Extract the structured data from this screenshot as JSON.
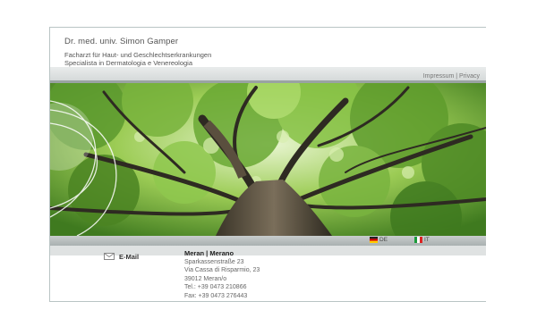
{
  "header": {
    "doctor_name": "Dr. med. univ. Simon Gamper",
    "subtitle_line1": "Facharzt für Haut- und Geschlechtserkrankungen",
    "subtitle_line2": "Specialista in Dermatologia e Venereologia"
  },
  "toplinks": {
    "impressum": "Impressum",
    "separator": "|",
    "privacy": "Privacy"
  },
  "hero": {
    "image_subject": "tree-canopy-photo"
  },
  "languages": [
    {
      "code": "DE",
      "icon": "german-flag-icon"
    },
    {
      "code": "IT",
      "icon": "italian-flag-icon"
    }
  ],
  "footer": {
    "email_label": "E-Mail",
    "city": "Meran | Merano",
    "street_de": "Sparkassenstraße 23",
    "street_it": "Via Cassa di Risparmio, 23",
    "zip_city": "39012 Meran/o",
    "tel": "Tel.: +39 0473 210866",
    "fax": "Fax: +39 0473 276443"
  },
  "colors": {
    "frame": "#b9c4c4",
    "bar": "#d4d8d8",
    "text": "#555555"
  }
}
